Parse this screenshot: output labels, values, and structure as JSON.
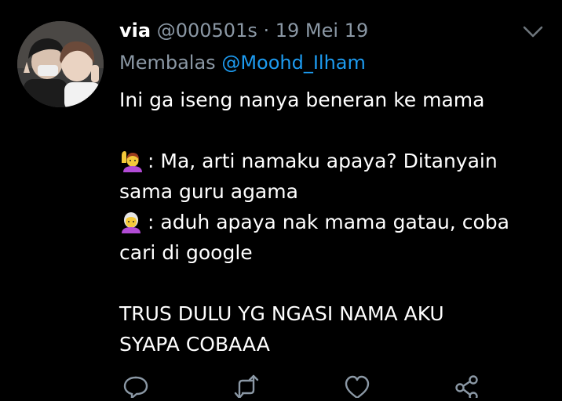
{
  "tweet": {
    "display_name": "via",
    "handle": "@000501s",
    "separator": "·",
    "date": "19 Mei 19",
    "reply_prefix": "Membalas",
    "reply_to": "@Moohd_Ilham",
    "lines": {
      "intro": "Ini ga iseng nanya beneran ke mama",
      "q1": ": Ma, arti namaku apaya? Ditanyain",
      "q2": "sama guru agama",
      "a1": ": aduh apaya nak mama gatau, coba",
      "a2": "cari di google",
      "end1": "TRUS DULU YG NGASI NAMA AKU",
      "end2": "SYAPA COBAAA"
    },
    "emojis": {
      "first": "person-raising-hand-emoji",
      "second": "old-woman-emoji"
    }
  },
  "icons": {
    "menu": "chevron-down-icon",
    "reply": "reply-icon",
    "retweet": "retweet-icon",
    "like": "heart-icon",
    "share": "share-icon"
  },
  "colors": {
    "background": "#000000",
    "text": "#ffffff",
    "secondary": "#8b98a5",
    "link": "#1d9bf0"
  }
}
